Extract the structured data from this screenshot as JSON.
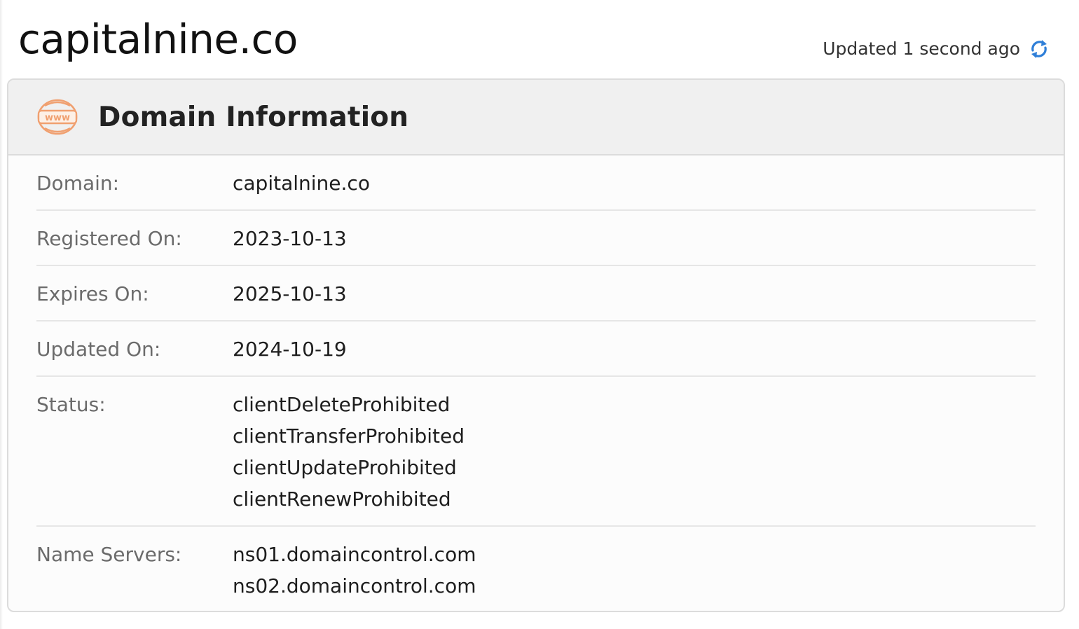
{
  "page": {
    "domain_title": "capitalnine.co",
    "updated_text": "Updated 1 second ago",
    "refresh_icon": "refresh-icon"
  },
  "card": {
    "icon": "www-icon",
    "icon_text": "www",
    "title": "Domain Information",
    "accent_color": "#f0a070",
    "refresh_color": "#2f7fd8"
  },
  "rows": {
    "domain": {
      "label": "Domain:",
      "value": "capitalnine.co"
    },
    "registered": {
      "label": "Registered On:",
      "value": "2023-10-13"
    },
    "expires": {
      "label": "Expires On:",
      "value": "2025-10-13"
    },
    "updated": {
      "label": "Updated On:",
      "value": "2024-10-19"
    },
    "status": {
      "label": "Status:",
      "values": [
        "clientDeleteProhibited",
        "clientTransferProhibited",
        "clientUpdateProhibited",
        "clientRenewProhibited"
      ]
    },
    "name_servers": {
      "label": "Name Servers:",
      "values": [
        "ns01.domaincontrol.com",
        "ns02.domaincontrol.com"
      ]
    }
  }
}
